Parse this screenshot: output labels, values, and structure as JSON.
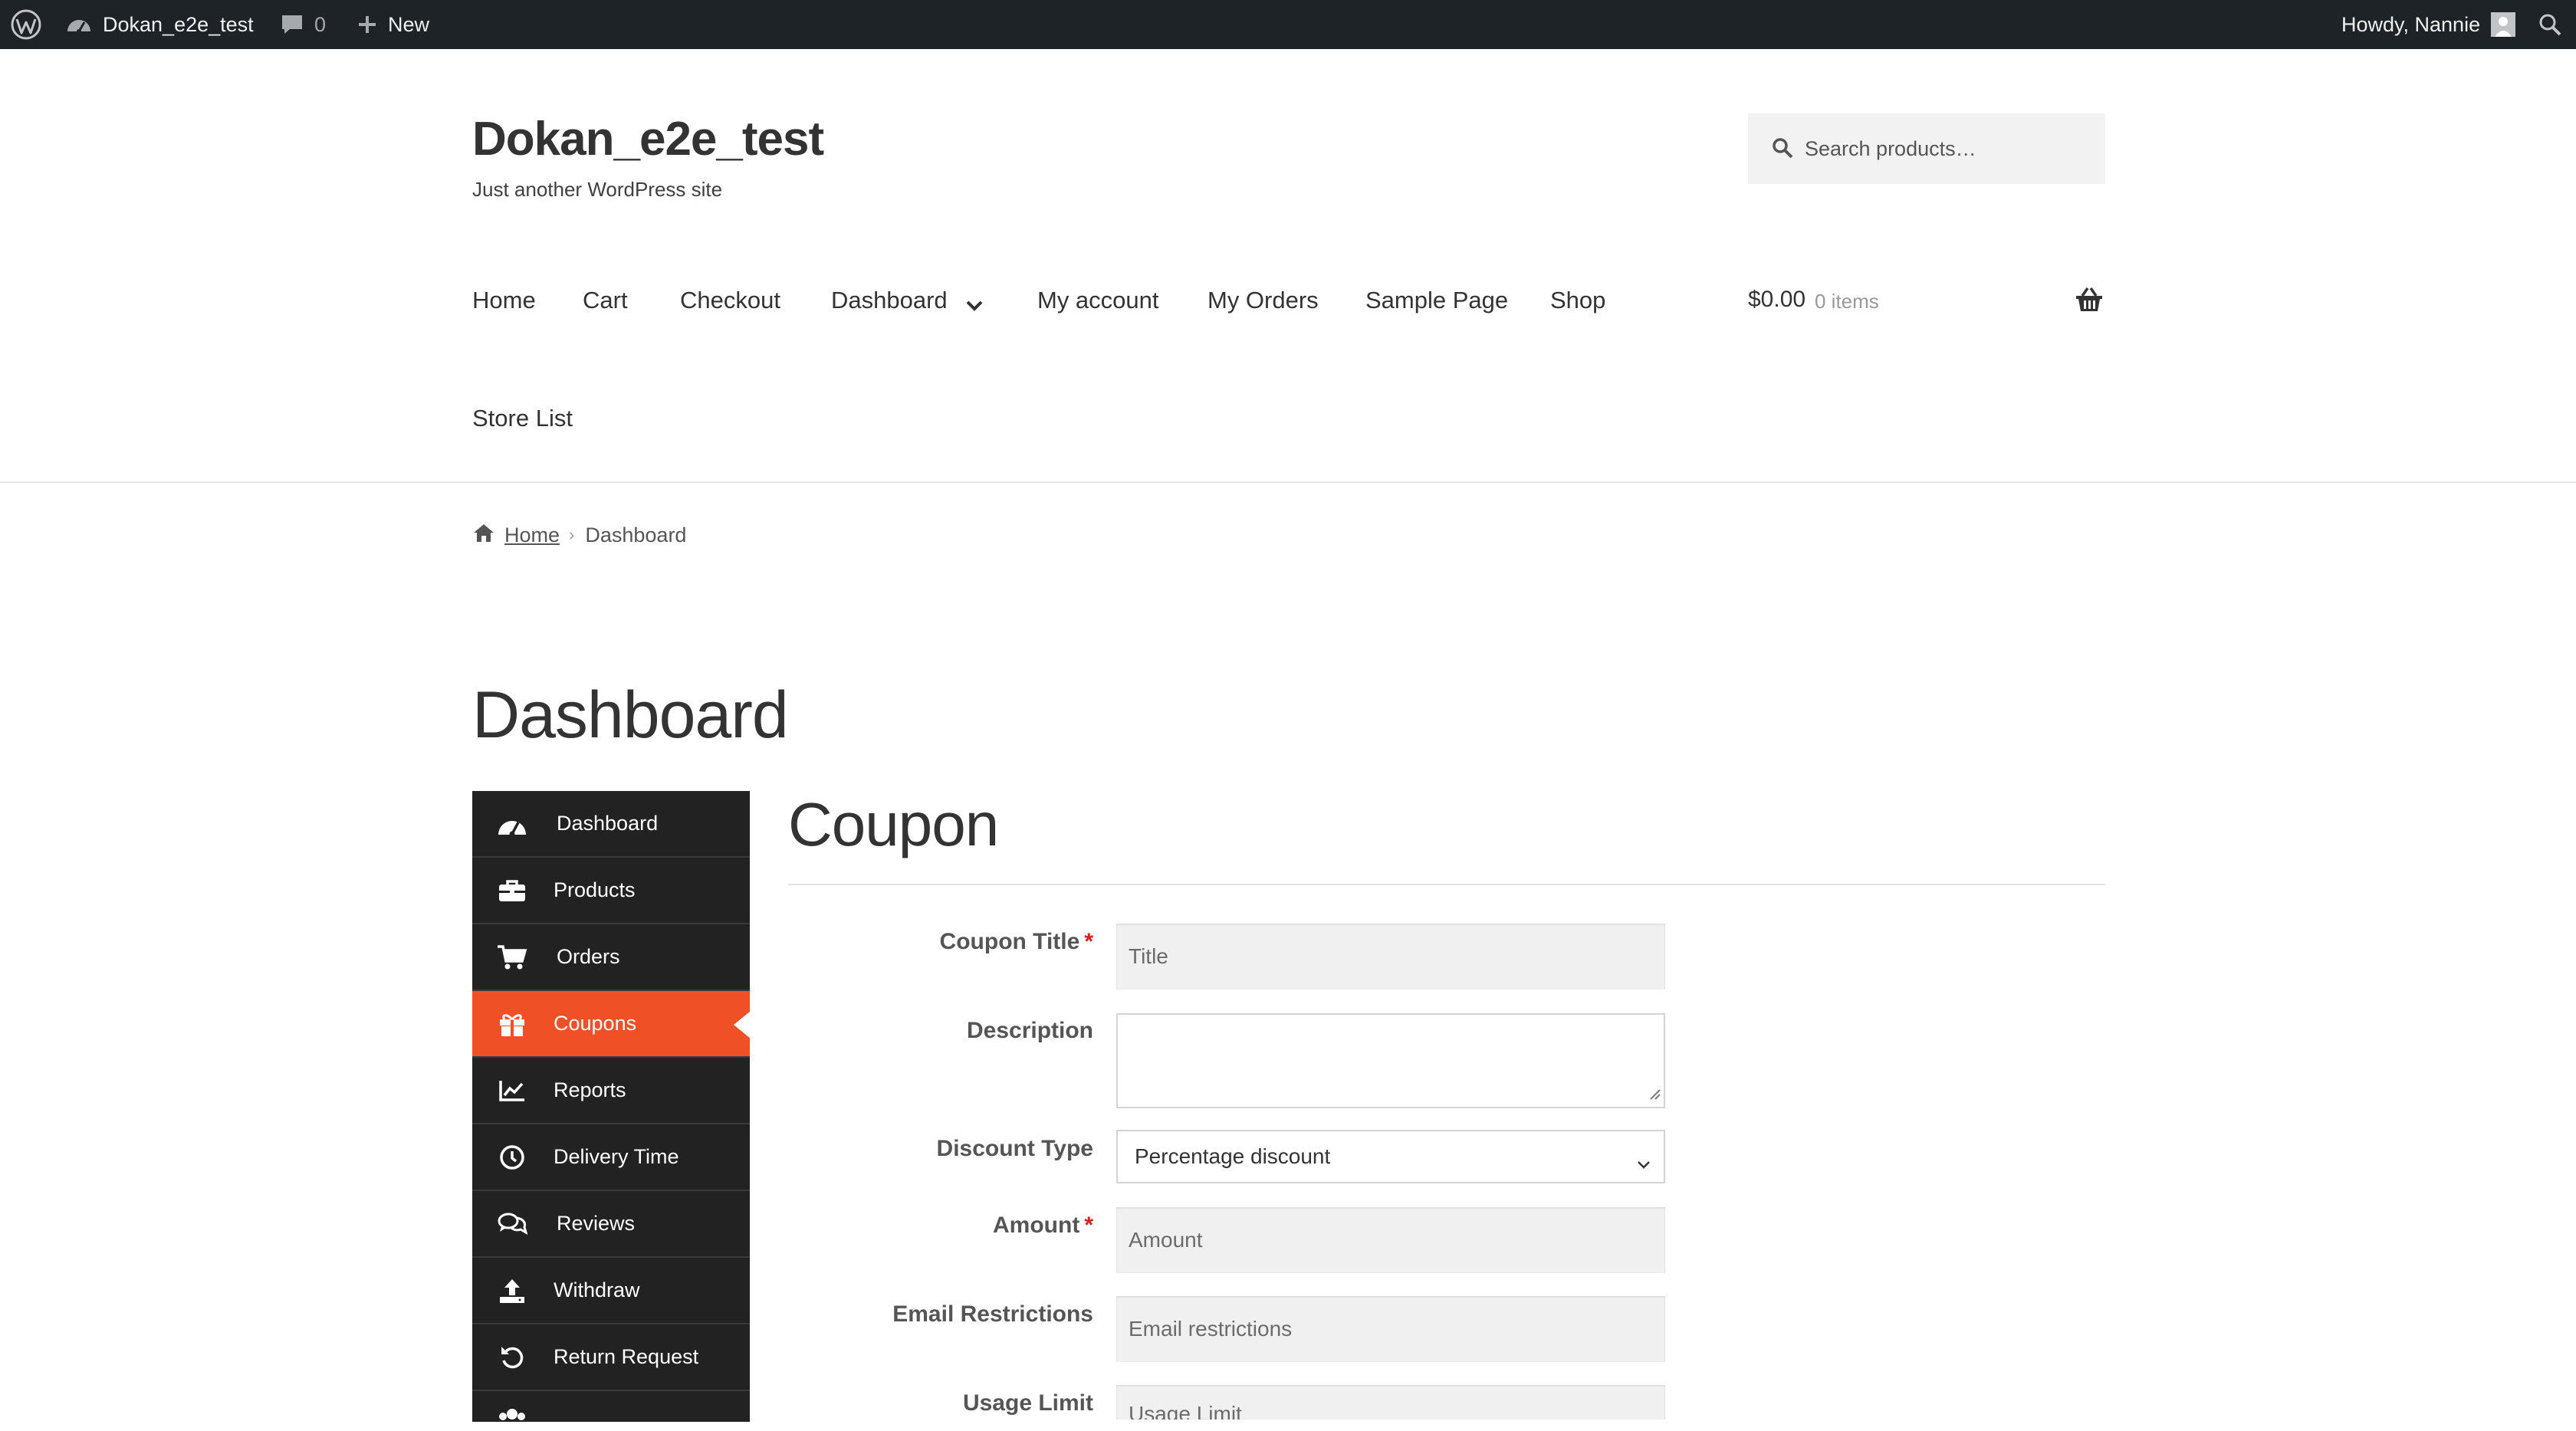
{
  "admin_bar": {
    "site_name": "Dokan_e2e_test",
    "comments_count": "0",
    "new_label": "New",
    "howdy": "Howdy, Nannie"
  },
  "site": {
    "title": "Dokan_e2e_test",
    "description": "Just another WordPress site"
  },
  "search": {
    "placeholder": "Search products…"
  },
  "nav": {
    "items": [
      "Home",
      "Cart",
      "Checkout",
      "Dashboard",
      "My account",
      "My Orders",
      "Sample Page",
      "Shop",
      "Store List"
    ]
  },
  "cart": {
    "total": "$0.00",
    "count": "0 items"
  },
  "breadcrumb": {
    "home": "Home",
    "current": "Dashboard"
  },
  "page": {
    "title": "Dashboard"
  },
  "sidebar": {
    "items": [
      {
        "label": "Dashboard",
        "icon": "dashboard-gauge-icon"
      },
      {
        "label": "Products",
        "icon": "briefcase-icon"
      },
      {
        "label": "Orders",
        "icon": "shopping-cart-icon"
      },
      {
        "label": "Coupons",
        "icon": "gift-icon",
        "active": true
      },
      {
        "label": "Reports",
        "icon": "line-chart-icon"
      },
      {
        "label": "Delivery Time",
        "icon": "clock-icon"
      },
      {
        "label": "Reviews",
        "icon": "comments-icon"
      },
      {
        "label": "Withdraw",
        "icon": "upload-icon"
      },
      {
        "label": "Return Request",
        "icon": "undo-icon"
      }
    ]
  },
  "coupon": {
    "heading": "Coupon",
    "fields": {
      "title_label": "Coupon Title",
      "title_placeholder": "Title",
      "description_label": "Description",
      "discount_type_label": "Discount Type",
      "discount_type_value": "Percentage discount",
      "amount_label": "Amount",
      "amount_placeholder": "Amount",
      "email_label": "Email Restrictions",
      "email_placeholder": "Email restrictions",
      "usage_limit_label": "Usage Limit",
      "usage_limit_placeholder": "Usage Limit"
    },
    "required_marker": "*"
  },
  "colors": {
    "admin_bar": "#1d2327",
    "sidebar": "#222222",
    "accent": "#f05025",
    "required": "#d81f1f"
  }
}
